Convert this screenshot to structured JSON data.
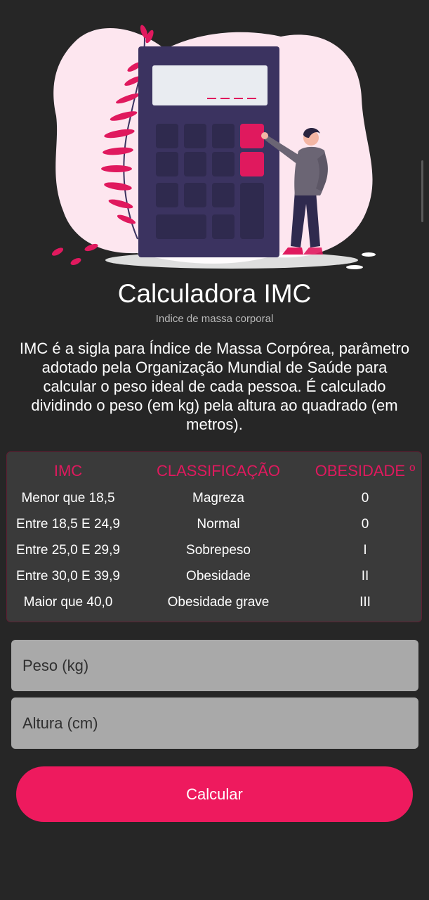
{
  "app": {
    "title": "Calculadora IMC",
    "subtitle": "Indice de massa corporal",
    "description": "IMC é a sigla para Índice de Massa Corpórea, parâmetro adotado pela Organização Mundial de Saúde para calcular o peso ideal de cada pessoa. É calculado dividindo o peso (em kg) pela altura ao quadrado (em metros)."
  },
  "table": {
    "headers": [
      "IMC",
      "CLASSIFICAÇÃO",
      "OBESIDADE º"
    ],
    "rows": [
      [
        "Menor que 18,5",
        "Magreza",
        "0"
      ],
      [
        "Entre 18,5 E 24,9",
        "Normal",
        "0"
      ],
      [
        "Entre 25,0 E 29,9",
        "Sobrepeso",
        "I"
      ],
      [
        "Entre 30,0 E 39,9",
        "Obesidade",
        "II"
      ],
      [
        "Maior que 40,0",
        "Obesidade grave",
        "III"
      ]
    ]
  },
  "form": {
    "weight_placeholder": "Peso (kg)",
    "height_placeholder": "Altura (cm)",
    "submit_label": "Calcular"
  },
  "colors": {
    "background": "#262626",
    "accent": "#ee1a5e",
    "table_bg": "#3a3a3a",
    "input_bg": "#a9a9a9"
  },
  "illustration": {
    "icon": "calculator-person-illustration"
  }
}
